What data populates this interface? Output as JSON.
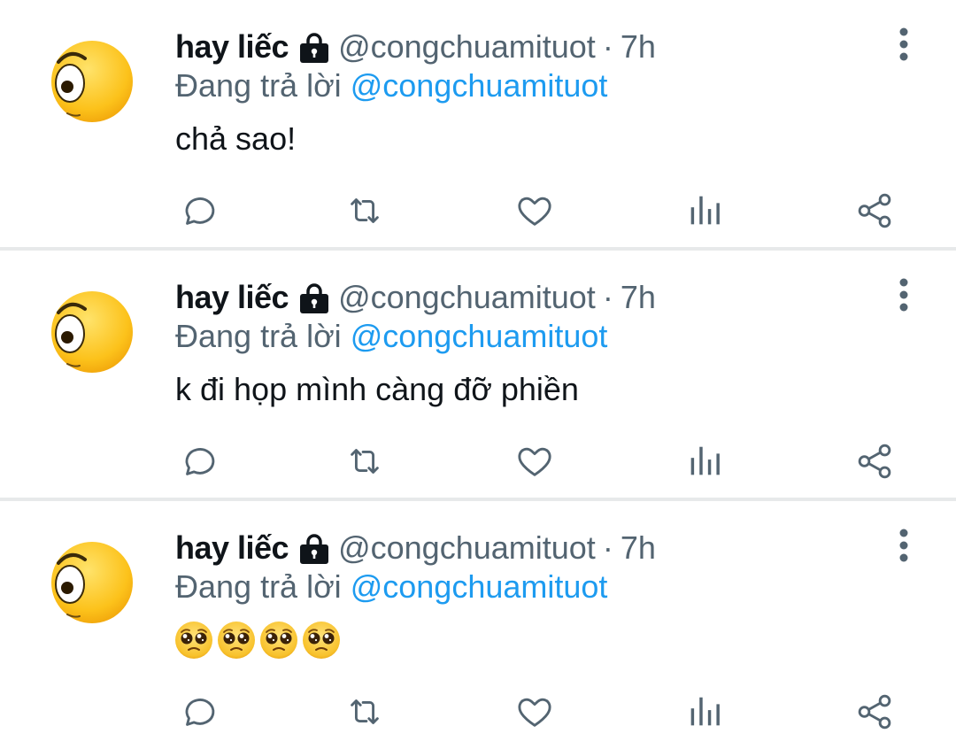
{
  "tweets": [
    {
      "name": "hay liếc",
      "handle": "@congchuamituot",
      "dot": "·",
      "time": "7h",
      "replying_prefix": "Đang trả lời",
      "replying_handle": "@congchuamituot",
      "text": "chả sao!"
    },
    {
      "name": "hay liếc",
      "handle": "@congchuamituot",
      "dot": "·",
      "time": "7h",
      "replying_prefix": "Đang trả lời",
      "replying_handle": "@congchuamituot",
      "text": "k đi họp mình càng đỡ phiền"
    },
    {
      "name": "hay liếc",
      "handle": "@congchuamituot",
      "dot": "·",
      "time": "7h",
      "replying_prefix": "Đang trả lời",
      "replying_handle": "@congchuamituot",
      "text": "🥺🥺🥺🥺"
    }
  ],
  "icons": {
    "avatar": "side-eye-emoji-avatar",
    "lock": "lock-icon",
    "more": "more-vertical-icon",
    "reply": "reply-icon",
    "retweet": "retweet-icon",
    "like": "heart-icon",
    "analytics": "analytics-icon",
    "share": "share-icon",
    "pleading": "pleading-face-emoji"
  },
  "colors": {
    "text": "#0f1419",
    "secondary": "#536471",
    "link": "#1d9bf0",
    "divider": "#e7e9ea"
  }
}
